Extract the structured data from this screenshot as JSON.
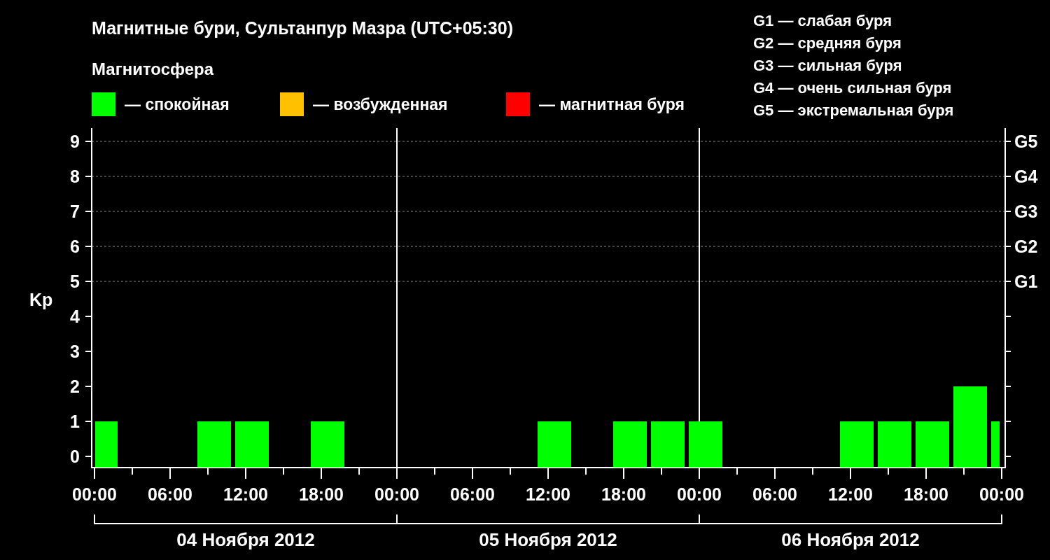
{
  "title": "Магнитные бури, Сультанпур Мазра (UTC+05:30)",
  "legend": {
    "title": "Магнитосфера",
    "items": [
      {
        "label": "— спокойная",
        "color": "#00ff00"
      },
      {
        "label": "— возбужденная",
        "color": "#ffc000"
      },
      {
        "label": "— магнитная буря",
        "color": "#ff0000"
      }
    ]
  },
  "storm_scale": [
    "G1 — слабая буря",
    "G2 — средняя буря",
    "G3 — сильная буря",
    "G4 — очень сильная буря",
    "G5 — экстремальная буря"
  ],
  "chart": {
    "right_axis_labels": [
      "G5",
      "G4",
      "G3",
      "G2",
      "G1"
    ],
    "day_labels": [
      "04 Ноября 2012",
      "05 Ноября 2012",
      "06 Ноября 2012"
    ],
    "chart_data": {
      "type": "bar",
      "xlim": [
        "2012-11-04T00:00",
        "2012-11-07T00:00"
      ],
      "ylim": [
        0,
        9
      ],
      "grid": true,
      "x": [
        "2012-11-04T01:00",
        "2012-11-04T09:30",
        "2012-11-04T12:30",
        "2012-11-04T18:30",
        "2012-11-05T12:30",
        "2012-11-05T18:30",
        "2012-11-05T21:30",
        "2012-11-06T00:30",
        "2012-11-06T12:30",
        "2012-11-06T15:30",
        "2012-11-06T18:30",
        "2012-11-06T21:30",
        "2012-11-06T23:30"
      ],
      "series": [
        {
          "name": "Kp",
          "color": "#00ff00",
          "values": [
            1,
            1,
            1,
            1,
            1,
            1,
            1,
            1,
            1,
            1,
            1,
            2,
            1
          ]
        }
      ],
      "yticks": [
        0,
        1,
        2,
        3,
        4,
        5,
        6,
        7,
        8,
        9
      ],
      "xticks": [
        {
          "value": "2012-11-04T00:00",
          "label": "00:00"
        },
        {
          "value": "2012-11-04T06:00",
          "label": "06:00"
        },
        {
          "value": "2012-11-04T12:00",
          "label": "12:00"
        },
        {
          "value": "2012-11-04T18:00",
          "label": "18:00"
        },
        {
          "value": "2012-11-05T00:00",
          "label": "00:00"
        },
        {
          "value": "2012-11-05T06:00",
          "label": "06:00"
        },
        {
          "value": "2012-11-05T12:00",
          "label": "12:00"
        },
        {
          "value": "2012-11-05T18:00",
          "label": "18:00"
        },
        {
          "value": "2012-11-06T00:00",
          "label": "00:00"
        },
        {
          "value": "2012-11-06T06:00",
          "label": "06:00"
        },
        {
          "value": "2012-11-06T12:00",
          "label": "12:00"
        },
        {
          "value": "2012-11-06T18:00",
          "label": "18:00"
        },
        {
          "value": "2012-11-07T00:00",
          "label": "00:00"
        }
      ]
    }
  }
}
